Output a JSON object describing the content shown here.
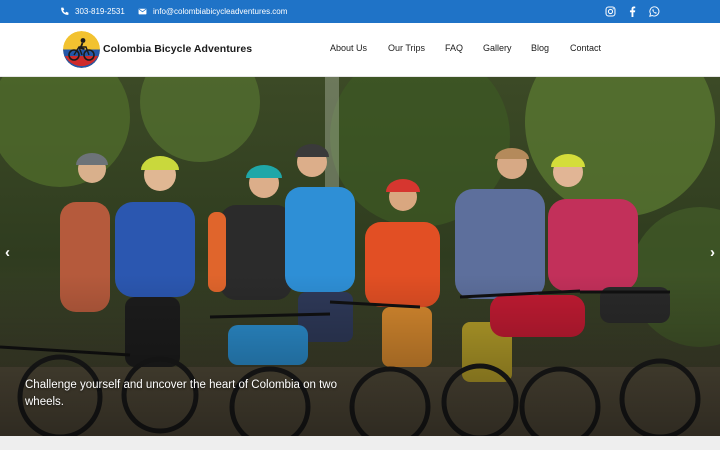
{
  "topbar": {
    "phone": "303-819-2531",
    "email": "info@colombiabicycleadventures.com",
    "icons": [
      "phone-icon",
      "envelope-icon",
      "instagram-icon",
      "facebook-icon",
      "whatsapp-icon"
    ]
  },
  "header": {
    "brand": "Colombia Bicycle Adventures",
    "nav": [
      "About Us",
      "Our Trips",
      "FAQ",
      "Gallery",
      "Blog",
      "Contact"
    ]
  },
  "hero": {
    "caption": "Challenge yourself and uncover the heart of Colombia on two wheels.",
    "prev_glyph": "‹",
    "next_glyph": "›"
  },
  "colors": {
    "topbar_bg": "#1f73c7",
    "nav_text": "#1b1b1b",
    "caption_text": "#ffffff"
  }
}
